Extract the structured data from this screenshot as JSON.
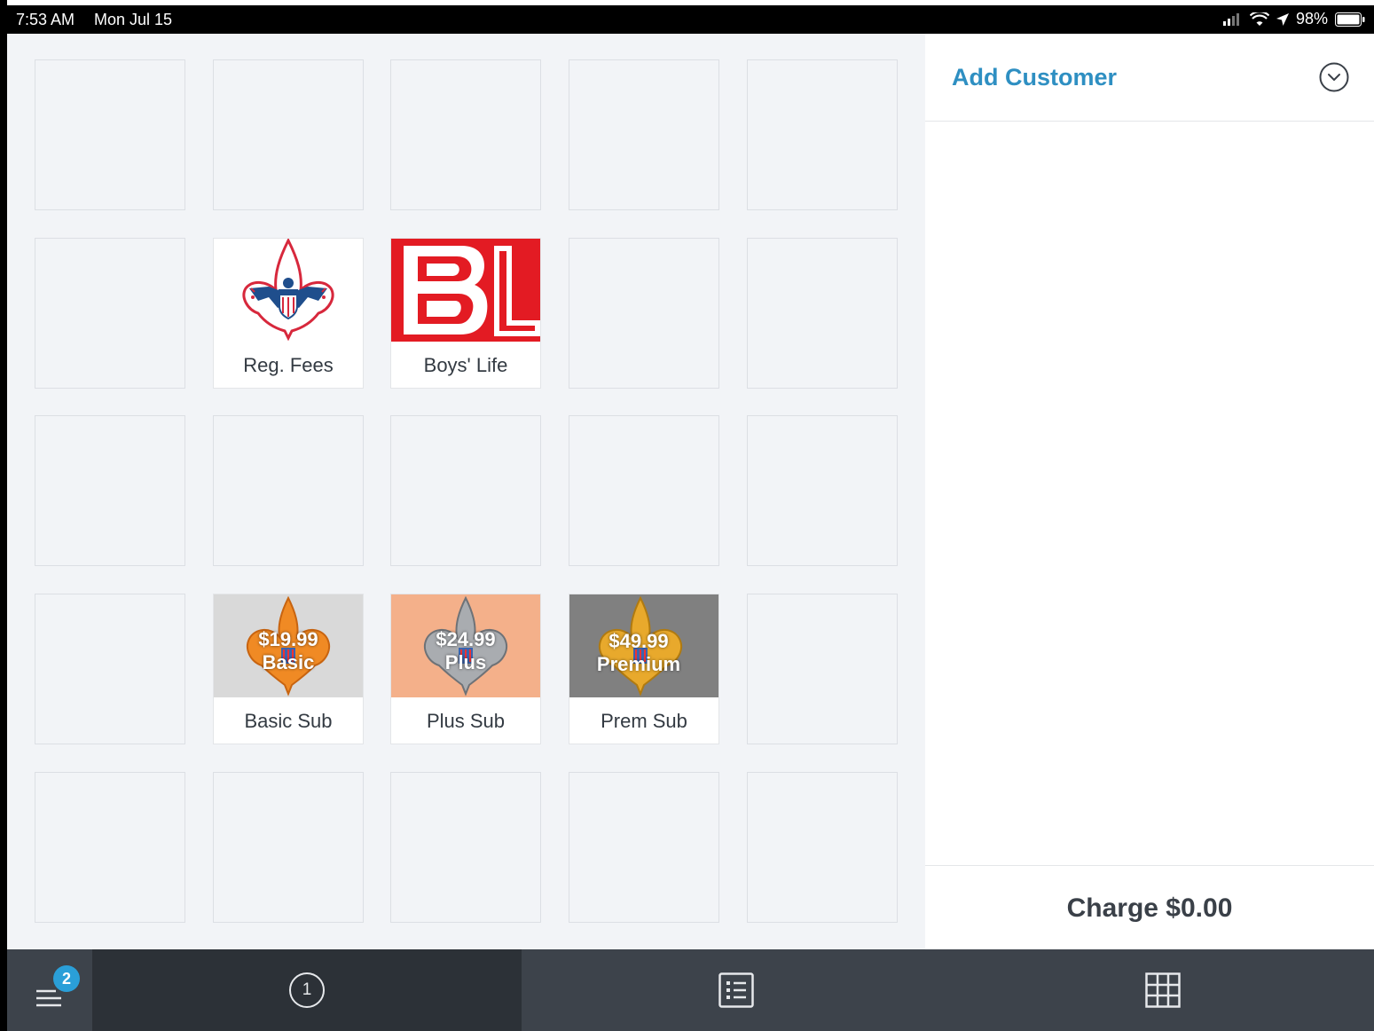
{
  "status_bar": {
    "time": "7:53 AM",
    "date": "Mon Jul 15",
    "battery": "98%"
  },
  "customer": {
    "add_label": "Add Customer"
  },
  "charge": {
    "label": "Charge $0.00"
  },
  "items": {
    "reg_fees": {
      "label": "Reg. Fees"
    },
    "boys_life": {
      "label": "Boys' Life"
    },
    "basic_sub": {
      "label": "Basic Sub",
      "price": "$19.99",
      "tier": "Basic"
    },
    "plus_sub": {
      "label": "Plus Sub",
      "price": "$24.99",
      "tier": "Plus"
    },
    "prem_sub": {
      "label": "Prem Sub",
      "price": "$49.99",
      "tier": "Premium"
    }
  },
  "bottom_bar": {
    "ticket_badge": "2",
    "cart_number": "1"
  },
  "colors": {
    "accent": "#2e8fc2",
    "bottom_bar": "#3d434b",
    "grid_bg": "#f2f4f7"
  },
  "icons": {
    "menu": "menu-icon",
    "cart": "cart-number-icon",
    "list": "list-icon",
    "grid": "grid-icon",
    "chevron": "chevron-down-circle-icon"
  }
}
